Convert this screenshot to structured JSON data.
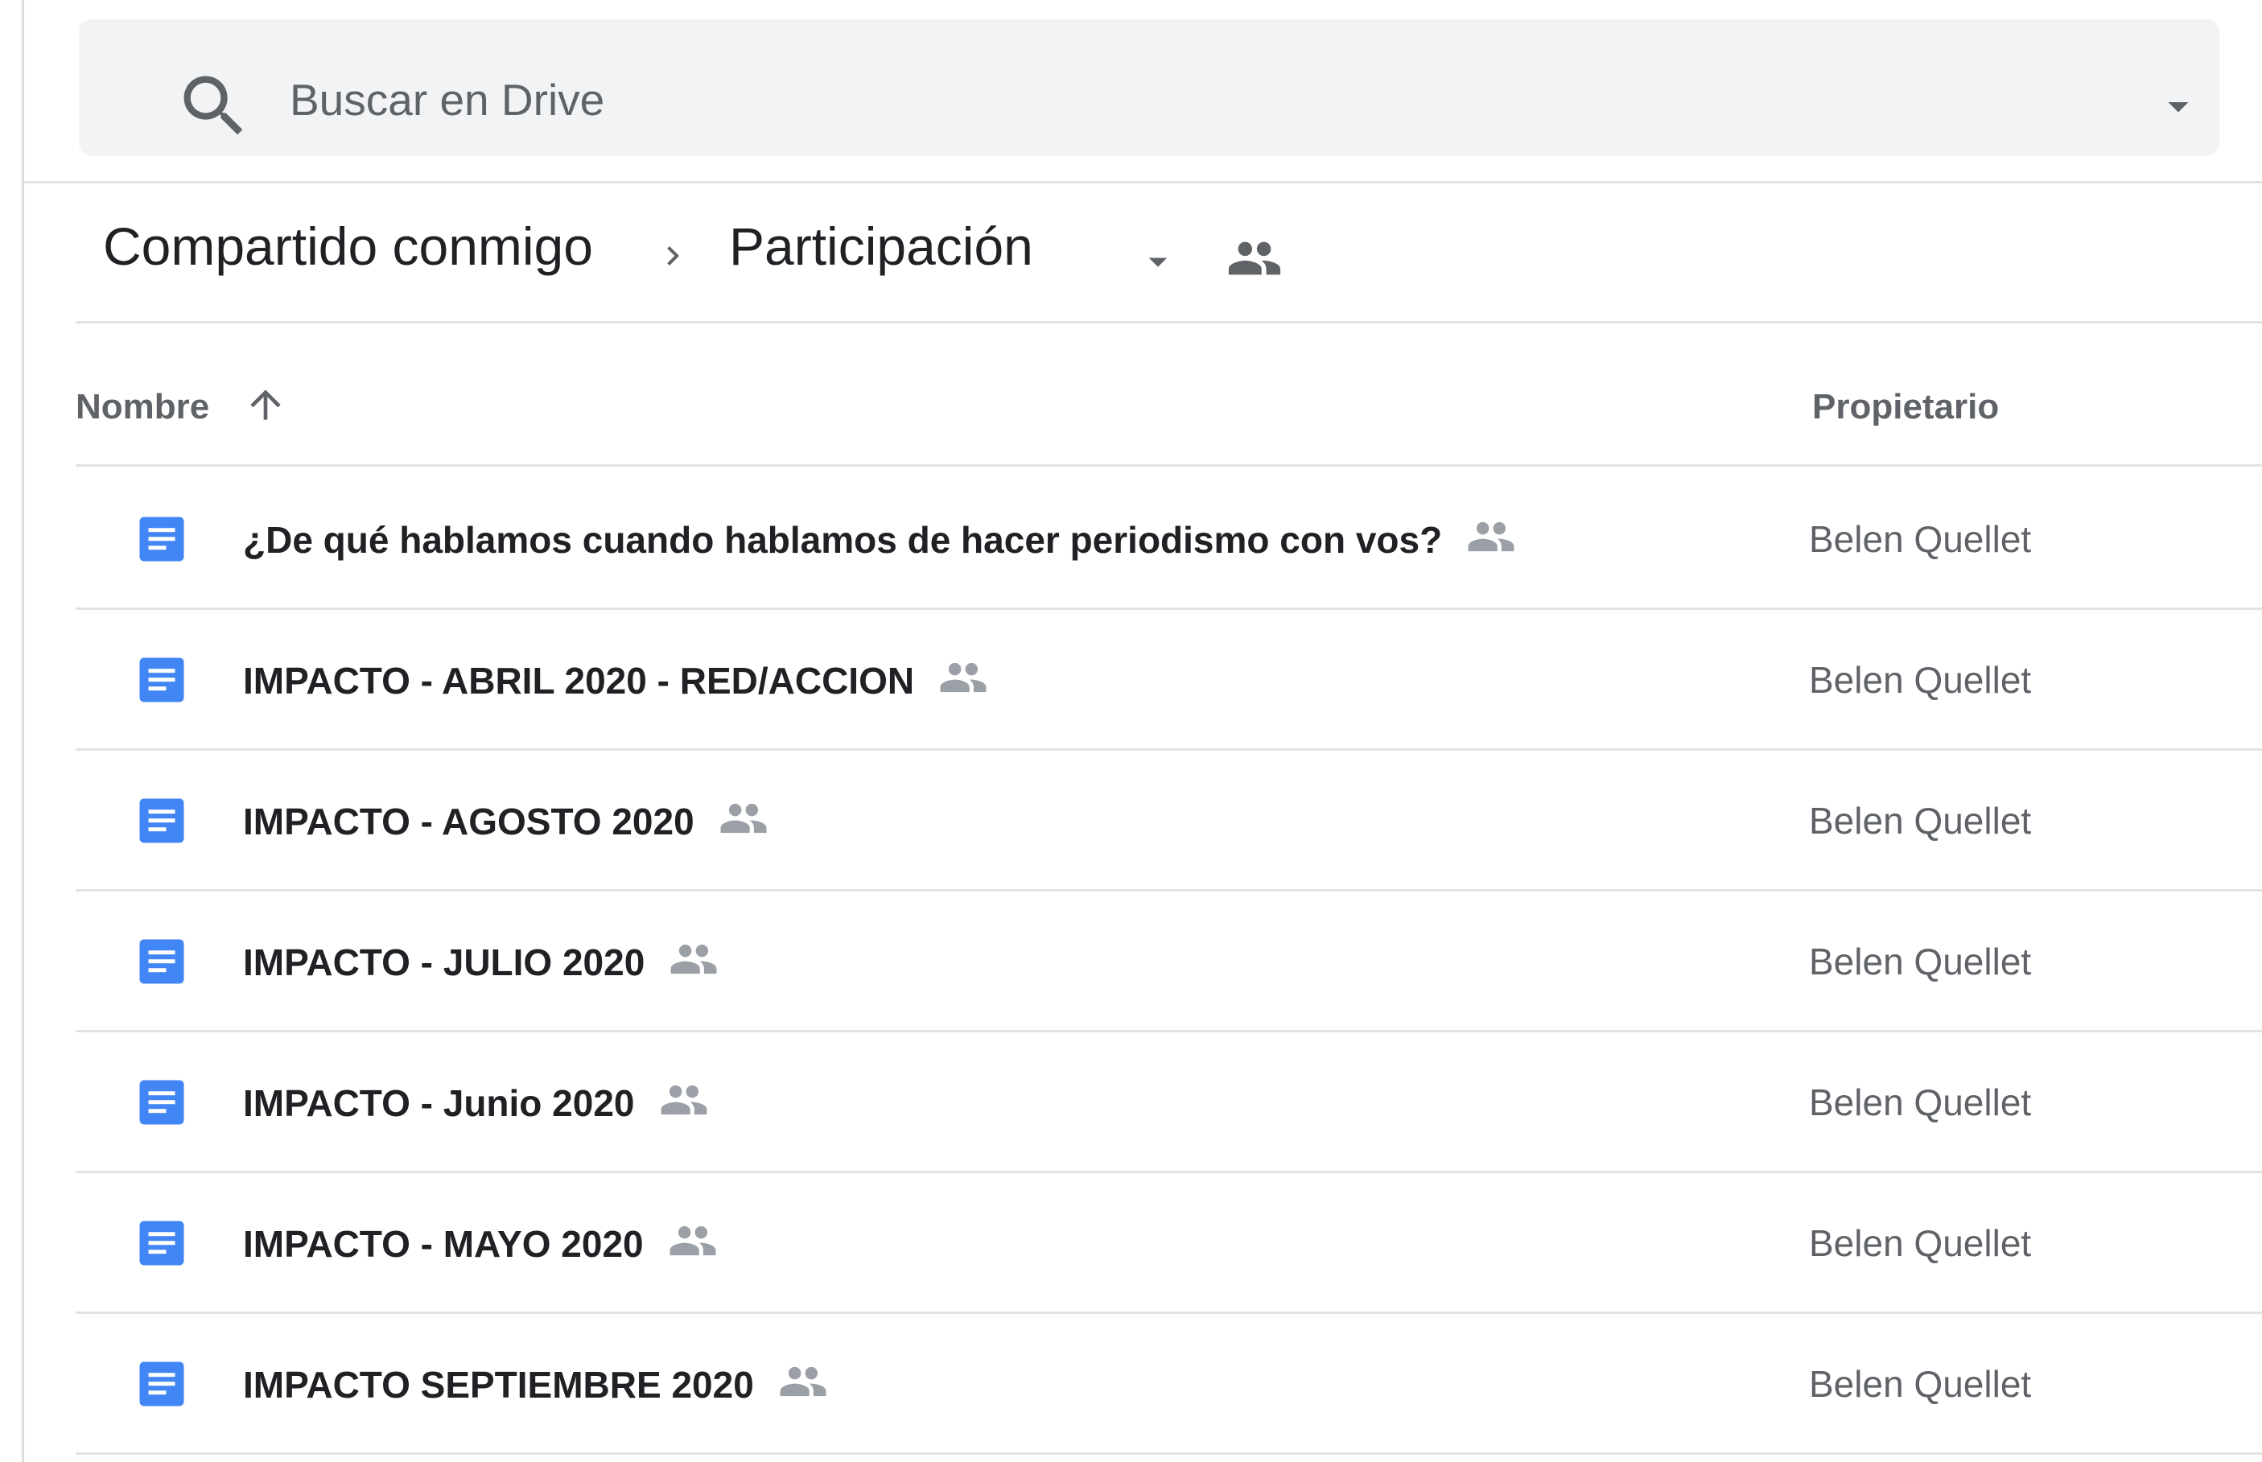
{
  "search": {
    "placeholder": "Buscar en Drive",
    "value": "",
    "icon": "search-icon",
    "options_icon": "arrow-drop-down-icon"
  },
  "breadcrumb": {
    "root": "Compartido conmigo",
    "separator_icon": "chevron-right-icon",
    "current": "Participación",
    "dropdown_icon": "arrow-drop-down-icon",
    "shared_icon": "people-icon"
  },
  "columns": {
    "name": "Nombre",
    "sort_icon": "arrow-up-icon",
    "owner": "Propietario"
  },
  "files": [
    {
      "name": "¿De qué hablamos cuando hablamos de hacer periodismo con vos?",
      "owner": "Belen Quellet",
      "type": "google-doc",
      "shared": true
    },
    {
      "name": "IMPACTO - ABRIL 2020 - RED/ACCION",
      "owner": "Belen Quellet",
      "type": "google-doc",
      "shared": true
    },
    {
      "name": "IMPACTO - AGOSTO 2020",
      "owner": "Belen Quellet",
      "type": "google-doc",
      "shared": true
    },
    {
      "name": "IMPACTO - JULIO 2020",
      "owner": "Belen Quellet",
      "type": "google-doc",
      "shared": true
    },
    {
      "name": "IMPACTO - Junio 2020",
      "owner": "Belen Quellet",
      "type": "google-doc",
      "shared": true
    },
    {
      "name": "IMPACTO - MAYO 2020",
      "owner": "Belen Quellet",
      "type": "google-doc",
      "shared": true
    },
    {
      "name": "IMPACTO SEPTIEMBRE 2020",
      "owner": "Belen Quellet",
      "type": "google-doc",
      "shared": true
    }
  ],
  "colors": {
    "doc_blue": "#4285f4",
    "text_primary": "#202124",
    "text_secondary": "#5f6368",
    "divider": "#e3e3e3",
    "search_bg": "#f1f3f4"
  }
}
